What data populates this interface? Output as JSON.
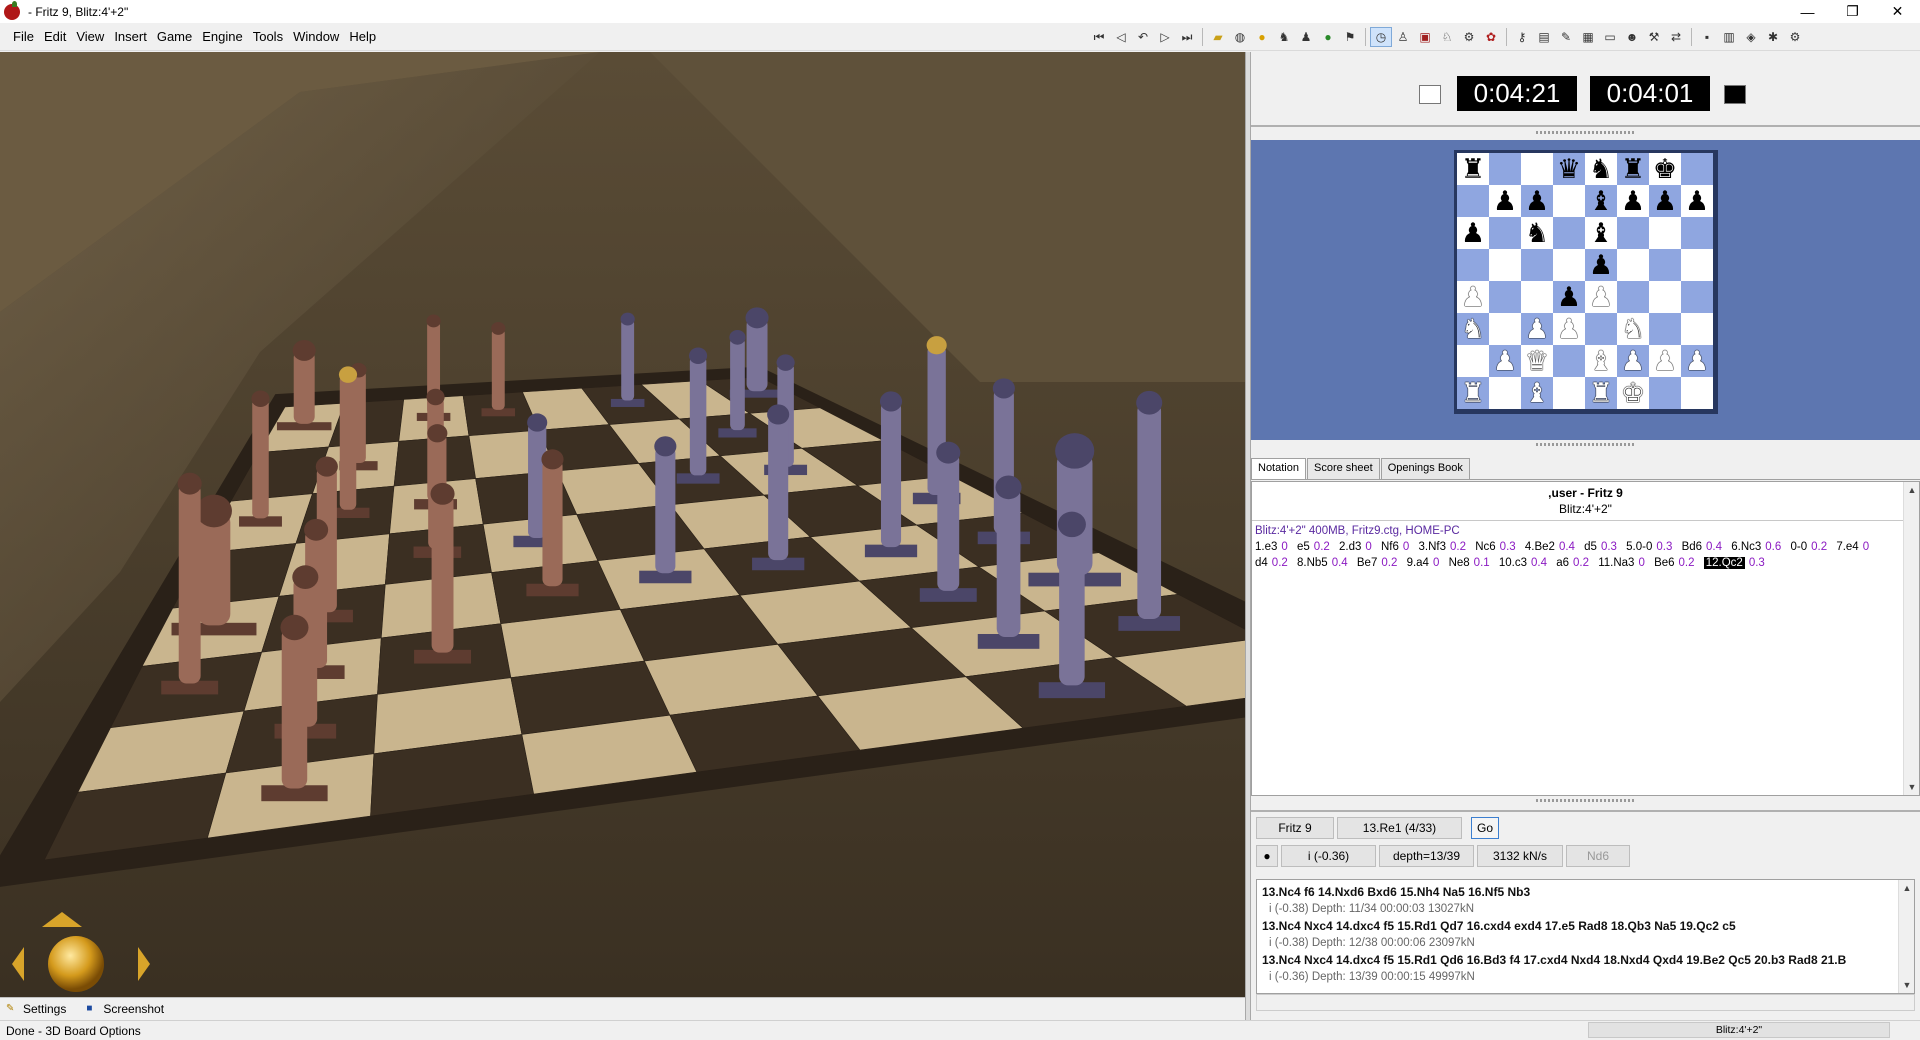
{
  "window": {
    "title": "- Fritz 9, Blitz:4'+2\"",
    "minimize": "—",
    "maximize": "❐",
    "close": "✕"
  },
  "menu": [
    "File",
    "Edit",
    "View",
    "Insert",
    "Game",
    "Engine",
    "Tools",
    "Window",
    "Help"
  ],
  "clock": {
    "white_time": "0:04:21",
    "black_time": "0:04:01"
  },
  "board": [
    [
      "bR",
      "",
      "",
      "bQ",
      "bN",
      "bR",
      "bK",
      ""
    ],
    [
      "",
      "bP",
      "bP",
      "",
      "bB",
      "bP",
      "bP",
      "bP"
    ],
    [
      "bP",
      "",
      "bN",
      "",
      "bB",
      "",
      "",
      ""
    ],
    [
      "",
      "",
      "",
      "",
      "bP",
      "",
      "",
      ""
    ],
    [
      "wP",
      "",
      "",
      "bP",
      "wP",
      "",
      "",
      ""
    ],
    [
      "wN",
      "",
      "wP",
      "wP",
      "",
      "wN",
      "",
      ""
    ],
    [
      "",
      "wP",
      "wQ",
      "",
      "wB",
      "wP",
      "wP",
      "wP"
    ],
    [
      "wR",
      "",
      "wB",
      "",
      "wR",
      "wK",
      "",
      ""
    ]
  ],
  "tabs": [
    "Notation",
    "Score sheet",
    "Openings Book"
  ],
  "notation": {
    "players": ",user - Fritz 9",
    "event": "Blitz:4'+2\"",
    "header": "Blitz:4'+2\"  400MB, Fritz9.ctg, HOME-PC",
    "moves": [
      {
        "m": "1.e3",
        "e": "0"
      },
      {
        "m": "e5",
        "e": "0.2"
      },
      {
        "m": "2.d3",
        "e": "0"
      },
      {
        "m": "Nf6",
        "e": "0"
      },
      {
        "m": "3.Nf3",
        "e": "0.2"
      },
      {
        "m": "Nc6",
        "e": "0.3"
      },
      {
        "m": "4.Be2",
        "e": "0.4"
      },
      {
        "m": "d5",
        "e": "0.3"
      },
      {
        "m": "5.0-0",
        "e": "0.3"
      },
      {
        "m": "Bd6",
        "e": "0.4"
      },
      {
        "m": "6.Nc3",
        "e": "0.6"
      },
      {
        "m": "0-0",
        "e": "0.2"
      },
      {
        "m": "7.e4",
        "e": "0"
      },
      {
        "m": "d4",
        "e": "0.2"
      },
      {
        "m": "8.Nb5",
        "e": "0.4"
      },
      {
        "m": "Be7",
        "e": "0.2"
      },
      {
        "m": "9.a4",
        "e": "0"
      },
      {
        "m": "Ne8",
        "e": "0.1"
      },
      {
        "m": "10.c3",
        "e": "0.4"
      },
      {
        "m": "a6",
        "e": "0.2"
      },
      {
        "m": "11.Na3",
        "e": "0"
      },
      {
        "m": "Be6",
        "e": "0.2"
      },
      {
        "m": "12.Qc2",
        "e": "0.3",
        "current": true
      }
    ]
  },
  "engine": {
    "name": "Fritz 9",
    "current_move": "13.Re1 (4/33)",
    "go_label": "Go",
    "eval": "i  (-0.36)",
    "depth": "depth=13/39",
    "speed": "3132 kN/s",
    "best": "Nd6",
    "lines": [
      {
        "pv": "13.Nc4 f6 14.Nxd6 Bxd6 15.Nh4 Na5 16.Nf5 Nb3",
        "info": "i  (-0.38)  Depth: 11/34   00:00:03  13027kN"
      },
      {
        "pv": "13.Nc4 Nxc4 14.dxc4 f5 15.Rd1 Qd7 16.cxd4 exd4 17.e5 Rad8 18.Qb3 Na5 19.Qc2 c5",
        "info": "i  (-0.38)  Depth: 12/38   00:00:06  23097kN"
      },
      {
        "pv": "13.Nc4 Nxc4 14.dxc4 f5 15.Rd1 Qd6 16.Bd3 f4 17.cxd4 Nxd4 18.Nxd4 Qxd4 19.Be2 Qc5 20.b3 Rad8 21.B",
        "info": "i  (-0.36)  Depth: 13/39   00:00:15  49997kN"
      }
    ]
  },
  "bottom_tabs": {
    "settings": "Settings",
    "screenshot": "Screenshot"
  },
  "status": {
    "left": "Done - 3D Board Options",
    "right": "Blitz:4'+2\""
  }
}
